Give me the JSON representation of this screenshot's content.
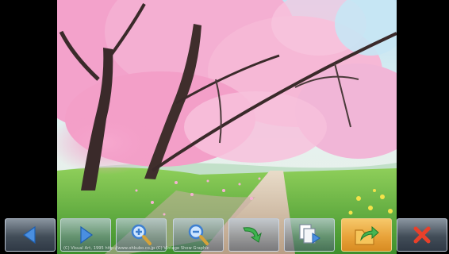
{
  "viewer": {
    "copyright_text": "(C) Visual Art, 1995 http://www.ohkubo.co.jp (C) Vintage Show Graphic"
  },
  "toolbar": {
    "buttons": [
      {
        "name": "prev-button",
        "icon": "arrow-left-icon",
        "color": "#4a8fe0"
      },
      {
        "name": "next-button",
        "icon": "arrow-right-icon",
        "color": "#4a8fe0"
      },
      {
        "name": "zoom-in-button",
        "icon": "zoom-in-icon",
        "color": "#4a8fe0"
      },
      {
        "name": "zoom-out-button",
        "icon": "zoom-out-icon",
        "color": "#4a8fe0"
      },
      {
        "name": "rotate-button",
        "icon": "rotate-arrow-icon",
        "color": "#3fb34f"
      },
      {
        "name": "slideshow-button",
        "icon": "slideshow-icon",
        "color": "#4a8fe0"
      },
      {
        "name": "share-button",
        "icon": "share-folder-icon",
        "color": "#f2a33a",
        "active": true
      },
      {
        "name": "close-button",
        "icon": "close-x-icon",
        "color": "#e8402a"
      }
    ]
  }
}
